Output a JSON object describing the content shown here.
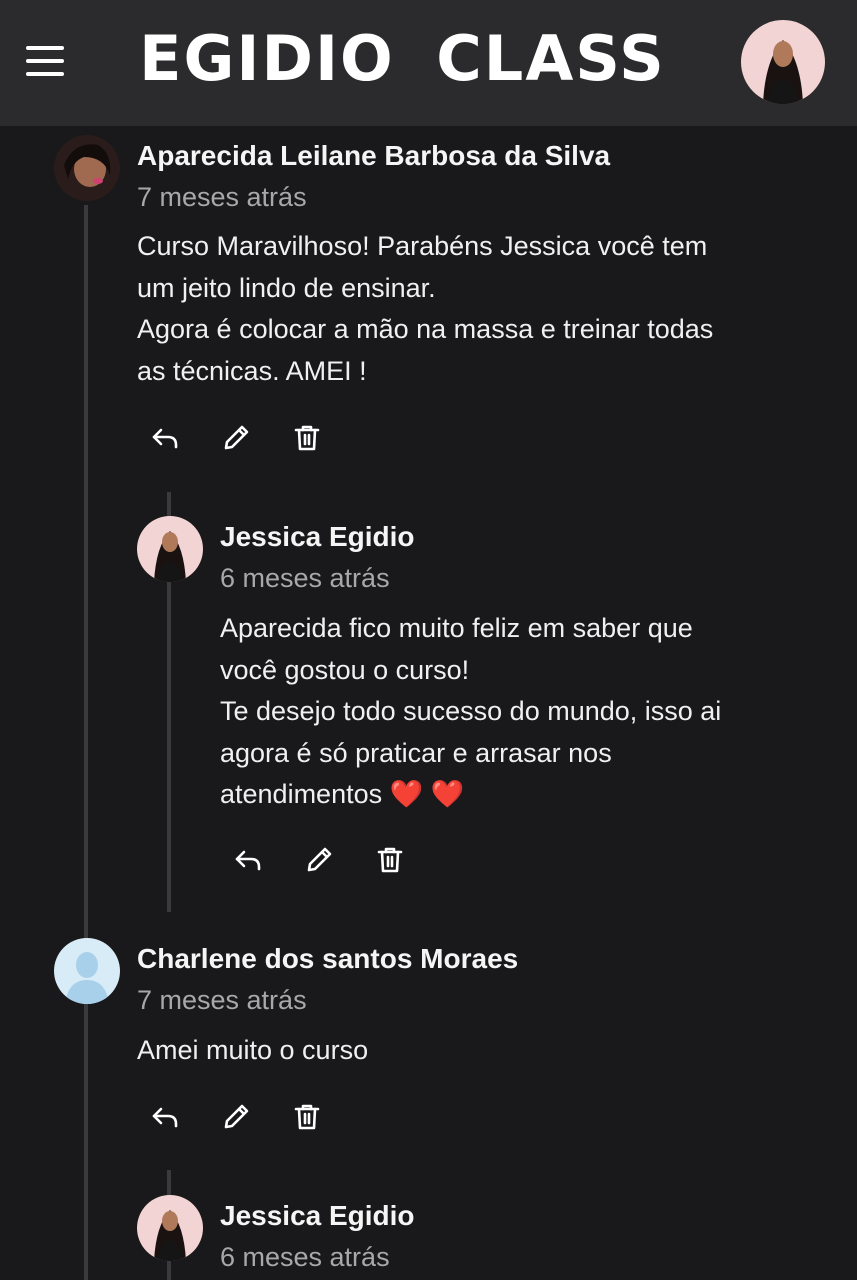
{
  "header": {
    "brand": "EGIDIO  CLASS",
    "menu_icon": "hamburger-menu-icon",
    "profile_avatar": "user-avatar"
  },
  "comments": [
    {
      "author": "Aparecida Leilane Barbosa da Silva",
      "time": "7 meses atrás",
      "lines": [
        "Curso Maravilhoso! Parabéns Jessica você tem",
        "um jeito lindo de ensinar.",
        "Agora é colocar a mão na massa e treinar todas",
        "as técnicas. AMEI !"
      ],
      "reply": {
        "author": "Jessica Egidio",
        "time": "6 meses atrás",
        "lines": [
          "Aparecida fico muito feliz em saber que",
          "você gostou o curso!",
          "Te desejo todo sucesso do mundo, isso ai",
          "agora é só praticar e arrasar nos",
          "atendimentos"
        ],
        "emoji": "❤️ ❤️"
      }
    },
    {
      "author": "Charlene dos santos Moraes",
      "time": "7 meses atrás",
      "lines": [
        "Amei muito o curso"
      ],
      "reply": {
        "author": "Jessica Egidio",
        "time": "6 meses atrás"
      }
    }
  ],
  "action_icons": [
    "reply-icon",
    "edit-pencil-icon",
    "delete-trash-icon"
  ],
  "colors": {
    "background": "#19191b",
    "header": "#2b2b2d",
    "muted_text": "#a8a8aa",
    "heart": "#e3162b"
  }
}
